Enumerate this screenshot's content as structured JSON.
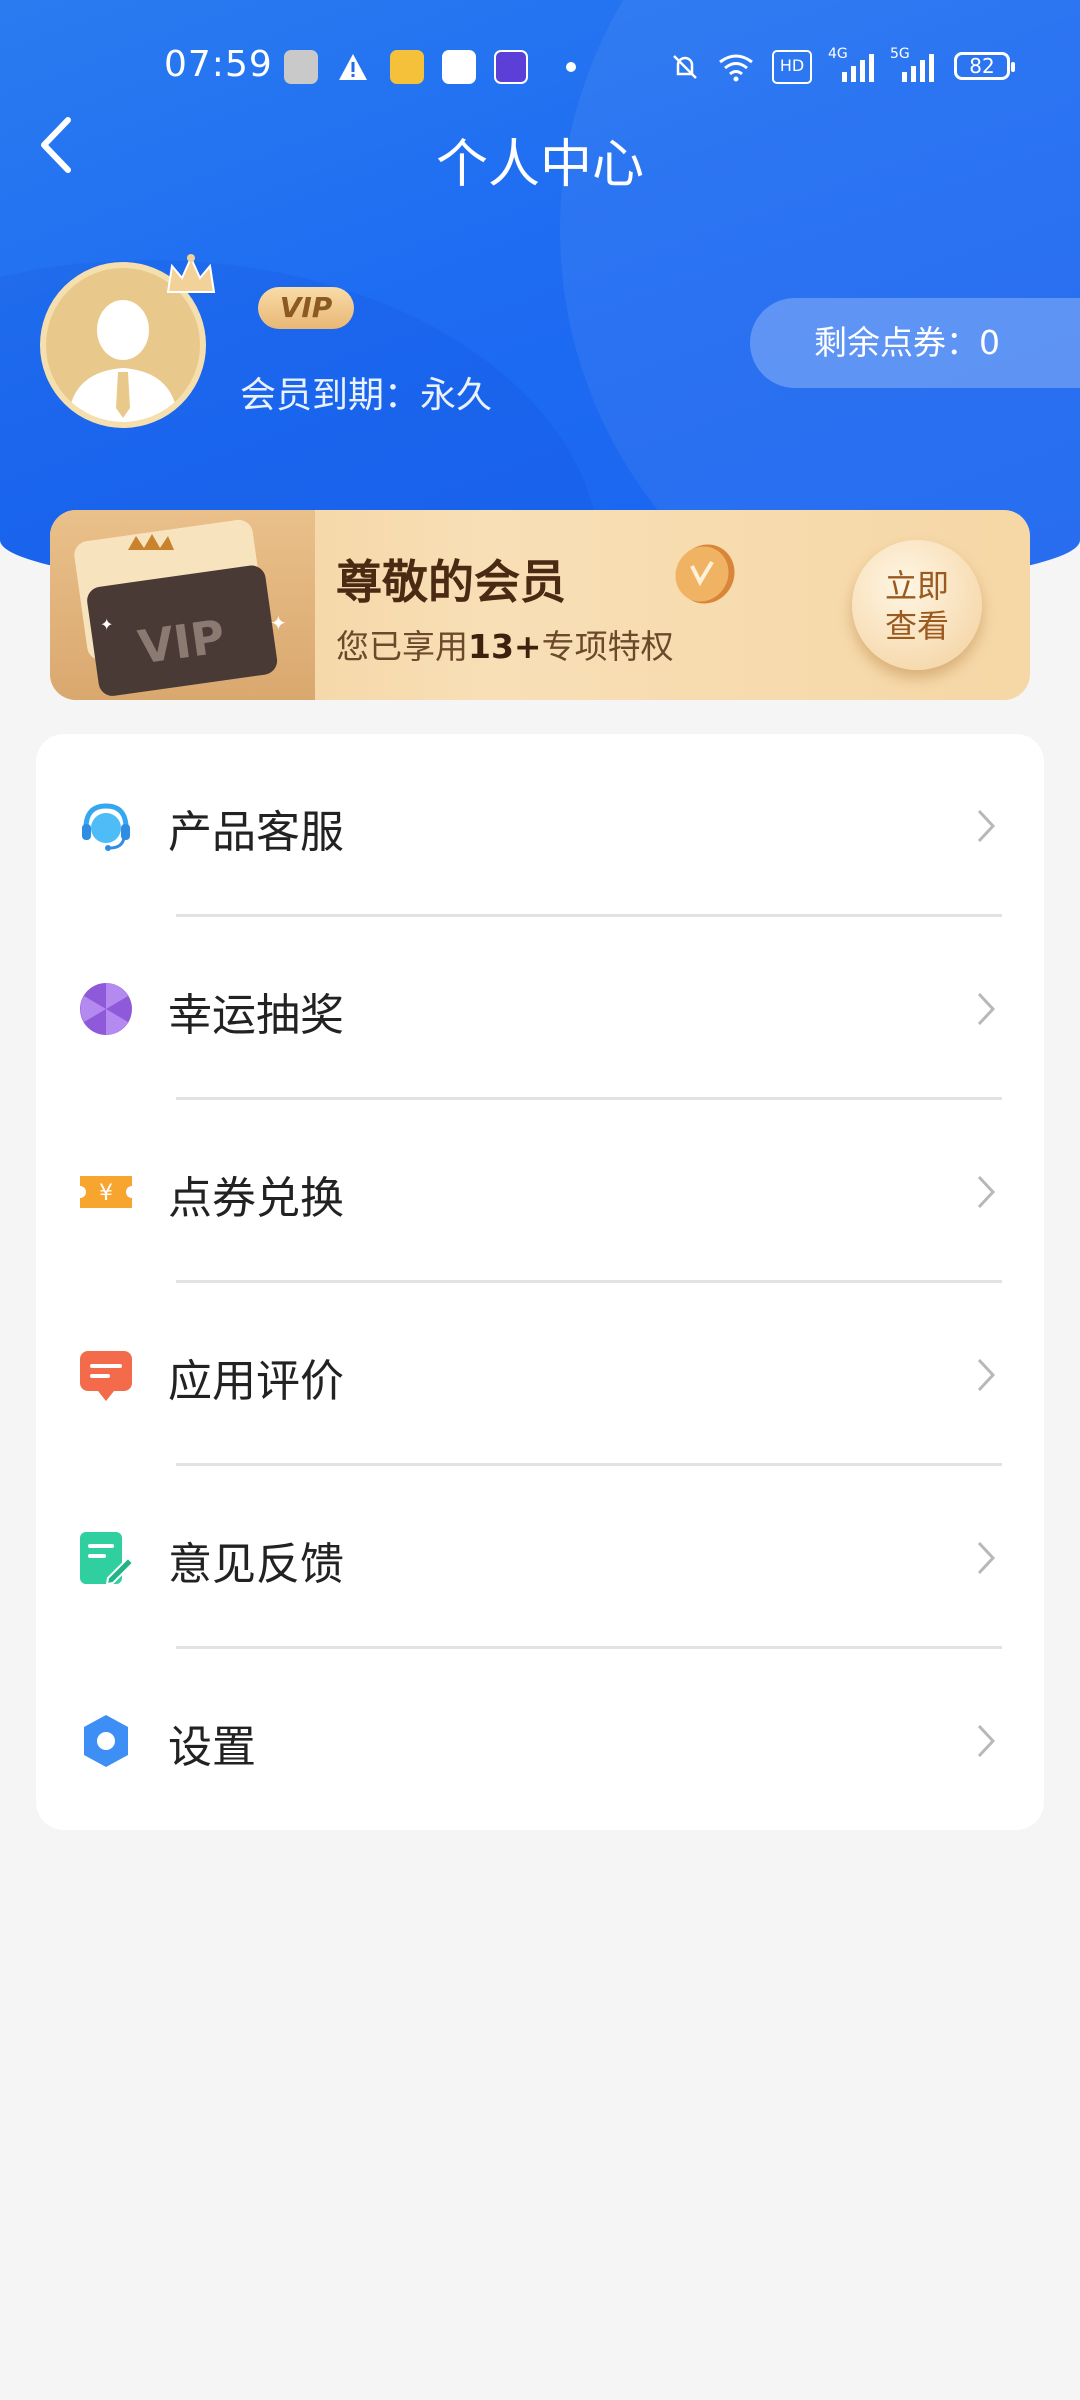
{
  "status_bar": {
    "time": "07:59",
    "battery": "82",
    "network": [
      "4G",
      "5G"
    ],
    "hd_label": "HD"
  },
  "header": {
    "title": "个人中心"
  },
  "profile": {
    "vip_badge": "VIP",
    "expire_label": "会员到期：永久",
    "points_label": "剩余点券：0"
  },
  "vip_banner": {
    "title": "尊敬的会员",
    "subtitle_prefix": "您已享用",
    "subtitle_highlight": "13+",
    "subtitle_suffix": "专项特权",
    "card_text": "VIP",
    "button_line1": "立即",
    "button_line2": "查看"
  },
  "menu": {
    "items": [
      {
        "label": "产品客服",
        "icon": "headset-icon"
      },
      {
        "label": "幸运抽奖",
        "icon": "lottery-icon"
      },
      {
        "label": "点券兑换",
        "icon": "coupon-icon"
      },
      {
        "label": "应用评价",
        "icon": "comment-icon"
      },
      {
        "label": "意见反馈",
        "icon": "feedback-icon"
      },
      {
        "label": "设置",
        "icon": "gear-icon"
      }
    ]
  },
  "colors": {
    "primary": "#1e6cf2",
    "gold": "#f3cf98",
    "background": "#f5f5f6"
  }
}
